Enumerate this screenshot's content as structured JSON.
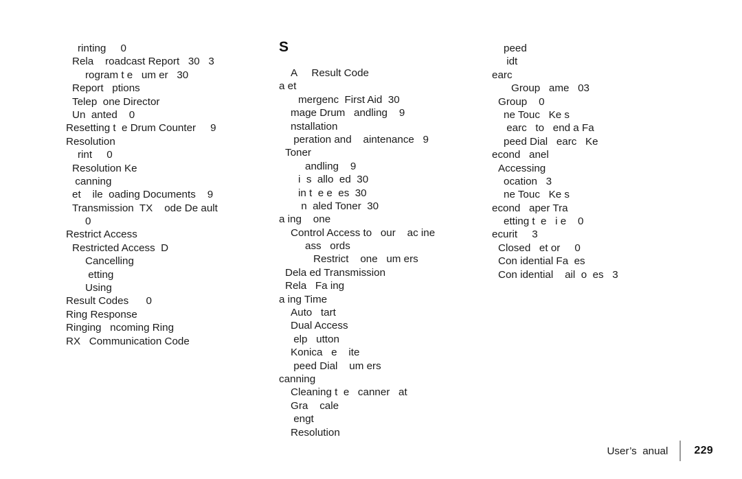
{
  "document": {
    "kind": "book-index-page",
    "page_number_label": "229",
    "footer_label": "User’s  anual"
  },
  "columns": {
    "left": {
      "name": "index-column-left",
      "letter_heading": "",
      "entries": [
        {
          "indent": 2,
          "text": "rinting     0"
        },
        {
          "indent": 1,
          "text": "Rela    roadcast Report   30   3"
        },
        {
          "indent": 3,
          "text": "rogram t e   um er   30"
        },
        {
          "indent": 1,
          "text": "Report   ptions"
        },
        {
          "indent": 1,
          "text": "Telep  one Director"
        },
        {
          "indent": 1,
          "text": "Un  anted    0"
        },
        {
          "indent": 0,
          "text": "Resetting t  e Drum Counter     9"
        },
        {
          "indent": 0,
          "text": "Resolution"
        },
        {
          "indent": 2,
          "text": "rint     0"
        },
        {
          "indent": 1,
          "text": "Resolution Ke"
        },
        {
          "indent": 1,
          "text": " canning"
        },
        {
          "indent": 1,
          "text": "et    ile  oading Documents    9"
        },
        {
          "indent": 1,
          "text": "Transmission  TX    ode De ault"
        },
        {
          "indent": 3,
          "text": "0"
        },
        {
          "indent": 0,
          "text": "Restrict Access"
        },
        {
          "indent": 1,
          "text": "Restricted Access  D"
        },
        {
          "indent": 3,
          "text": "Cancelling"
        },
        {
          "indent": 3,
          "text": " etting"
        },
        {
          "indent": 3,
          "text": "Using"
        },
        {
          "indent": 0,
          "text": "Result Codes      0"
        },
        {
          "indent": 0,
          "text": "Ring Response"
        },
        {
          "indent": 0,
          "text": "Ringing   ncoming Ring"
        },
        {
          "indent": 0,
          "text": "RX   Communication Code"
        }
      ]
    },
    "mid": {
      "name": "index-column-mid",
      "letter_heading": "S",
      "entries": [
        {
          "indent": 2,
          "text": "A     Result Code"
        },
        {
          "indent": 0,
          "text": "a et"
        },
        {
          "indent": 3,
          "text": "mergenc  First Aid  30"
        },
        {
          "indent": 2,
          "text": "mage Drum   andling    9"
        },
        {
          "indent": 2,
          "text": "nstallation"
        },
        {
          "indent": 2,
          "text": " peration and    aintenance   9"
        },
        {
          "indent": 1,
          "text": "Toner"
        },
        {
          "indent": 4,
          "text": "andling    9"
        },
        {
          "indent": 3,
          "text": "i  s  allo  ed  30"
        },
        {
          "indent": 3,
          "text": "in t  e e  es  30"
        },
        {
          "indent": 3,
          "text": " n  aled Toner  30"
        },
        {
          "indent": 0,
          "text": "a ing    one"
        },
        {
          "indent": 2,
          "text": "Control Access to   our    ac ine"
        },
        {
          "indent": 4,
          "text": "ass   ords"
        },
        {
          "indent": 5,
          "text": "Restrict    one   um ers"
        },
        {
          "indent": 1,
          "text": "Dela ed Transmission"
        },
        {
          "indent": 1,
          "text": "Rela   Fa ing"
        },
        {
          "indent": 0,
          "text": "a ing Time"
        },
        {
          "indent": 2,
          "text": "Auto   tart"
        },
        {
          "indent": 2,
          "text": "Dual Access"
        },
        {
          "indent": 2,
          "text": " elp   utton"
        },
        {
          "indent": 2,
          "text": "Konica   e    ite"
        },
        {
          "indent": 2,
          "text": " peed Dial    um ers"
        },
        {
          "indent": 0,
          "text": "canning"
        },
        {
          "indent": 2,
          "text": "Cleaning t  e   canner   at"
        },
        {
          "indent": 2,
          "text": "Gra    cale"
        },
        {
          "indent": 2,
          "text": " engt"
        },
        {
          "indent": 2,
          "text": "Resolution"
        }
      ]
    },
    "right": {
      "name": "index-column-right",
      "letter_heading": "",
      "entries": [
        {
          "indent": 2,
          "text": "peed"
        },
        {
          "indent": 2,
          "text": " idt"
        },
        {
          "indent": 0,
          "text": "earc"
        },
        {
          "indent": 3,
          "text": "Group   ame   03"
        },
        {
          "indent": 1,
          "text": "Group    0"
        },
        {
          "indent": 2,
          "text": "ne Touc   Ke s"
        },
        {
          "indent": 2,
          "text": " earc   to   end a Fa"
        },
        {
          "indent": 2,
          "text": "peed Dial   earc   Ke"
        },
        {
          "indent": 0,
          "text": "econd   anel"
        },
        {
          "indent": 1,
          "text": "Accessing"
        },
        {
          "indent": 2,
          "text": "ocation   3"
        },
        {
          "indent": 2,
          "text": "ne Touc   Ke s"
        },
        {
          "indent": 0,
          "text": "econd   aper Tra"
        },
        {
          "indent": 2,
          "text": "etting t  e   i e    0"
        },
        {
          "indent": 0,
          "text": "ecurit     3"
        },
        {
          "indent": 1,
          "text": "Closed   et or     0"
        },
        {
          "indent": 1,
          "text": "Con idential Fa  es"
        },
        {
          "indent": 1,
          "text": "Con idential    ail  o  es   3"
        }
      ]
    }
  }
}
